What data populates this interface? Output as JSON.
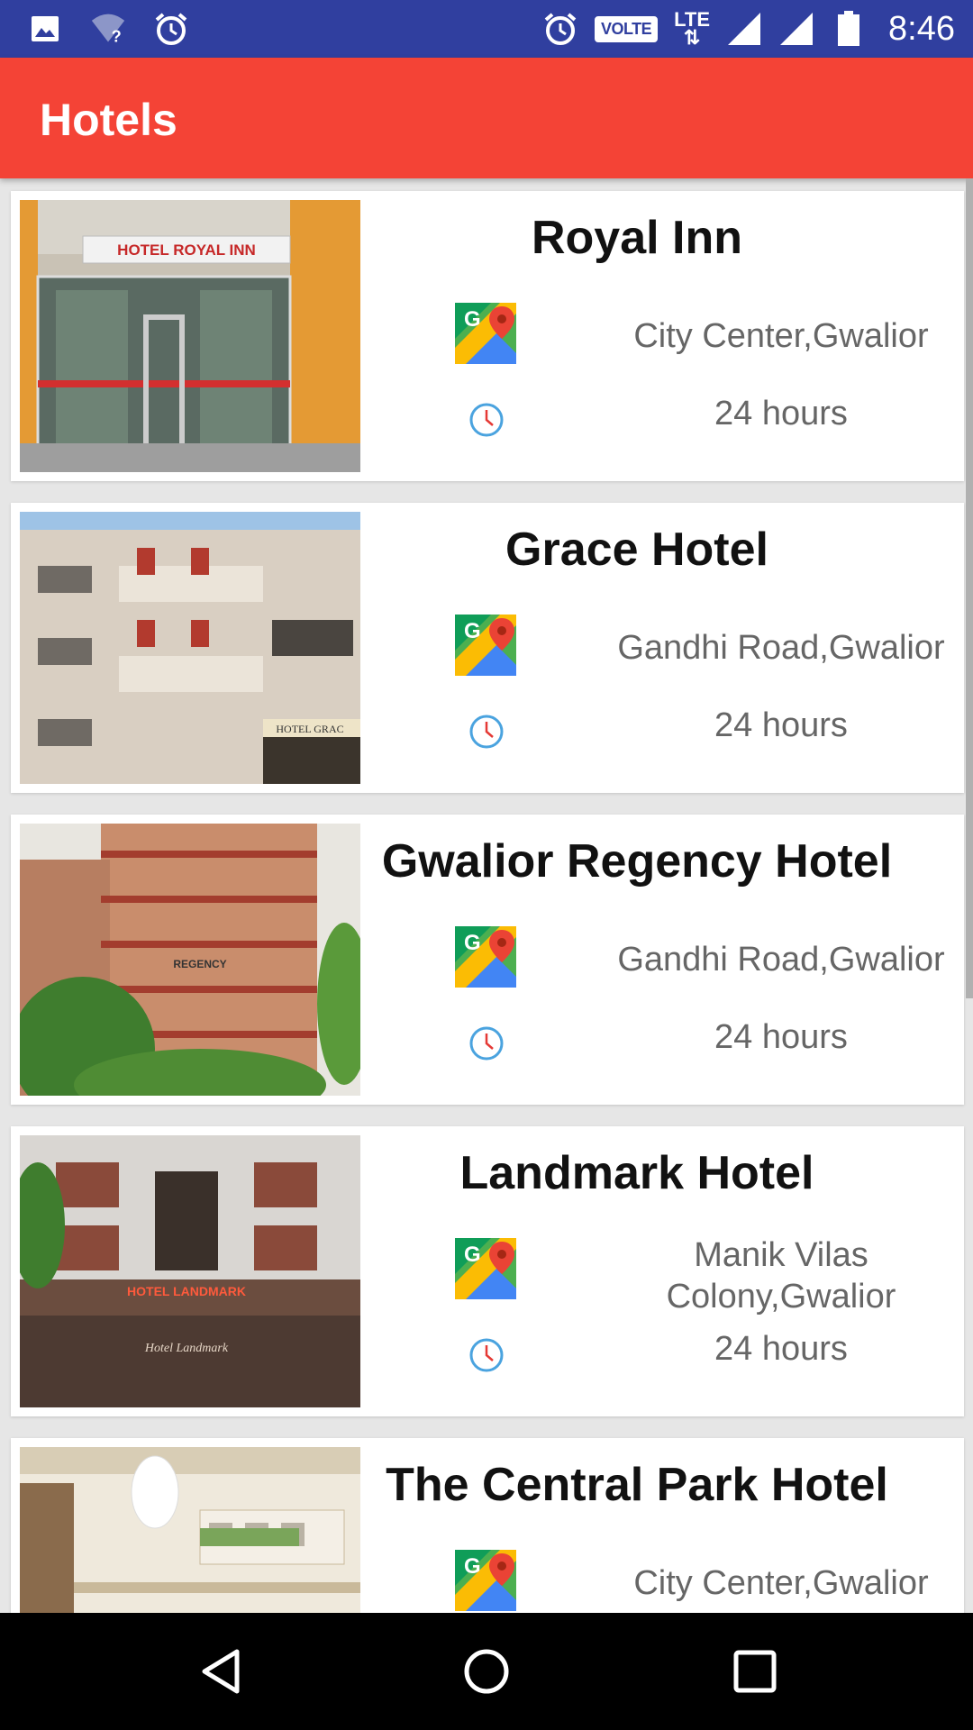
{
  "status_bar": {
    "time": "8:46",
    "volte": "VOLTE",
    "lte": "LTE"
  },
  "app_bar": {
    "title": "Hotels"
  },
  "hotels": [
    {
      "name": "Royal Inn",
      "address": "City Center,Gwalior",
      "hours": "24 hours",
      "sign": "HOTEL ROYAL INN"
    },
    {
      "name": "Grace Hotel",
      "address": "Gandhi Road,Gwalior",
      "hours": "24 hours",
      "sign": "HOTEL GRAC"
    },
    {
      "name": "Gwalior Regency Hotel",
      "address": "Gandhi Road,Gwalior",
      "hours": "24 hours",
      "sign": "REGENCY"
    },
    {
      "name": "Landmark Hotel",
      "address": "Manik Vilas Colony,Gwalior",
      "hours": "24 hours",
      "sign": "HOTEL LANDMARK"
    },
    {
      "name": "The Central Park Hotel",
      "address": "City Center,Gwalior",
      "hours": ""
    }
  ],
  "icons": {
    "map": "google-maps-icon",
    "clock": "clock-icon",
    "back": "back-triangle-icon",
    "home": "home-circle-icon",
    "recents": "recents-square-icon"
  },
  "colors": {
    "status_bar": "#303f9f",
    "app_bar": "#f44336"
  }
}
